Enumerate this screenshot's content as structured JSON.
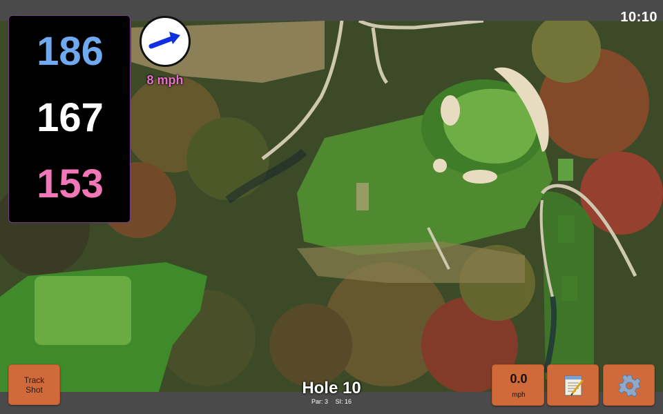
{
  "status": {
    "clock": "10:10"
  },
  "distances": {
    "back": "186",
    "middle": "167",
    "front": "153"
  },
  "wind": {
    "speed_label": "8 mph",
    "direction_icon": "arrow-up-right-icon",
    "arrow_color": "#1030e0"
  },
  "hole": {
    "title": "Hole 10",
    "par_label": "Par: 3",
    "si_label": "SI: 16"
  },
  "buttons": {
    "track_shot_line1": "Track",
    "track_shot_line2": "Shot",
    "speed_value": "0.0",
    "speed_unit": "mph",
    "notes_icon": "notepad-icon",
    "settings_icon": "gear-icon"
  },
  "colors": {
    "back_distance": "#6fa9f0",
    "middle_distance": "#ffffff",
    "front_distance": "#f277b8",
    "button": "#d06a3a",
    "wind_text": "#e66fc8"
  }
}
